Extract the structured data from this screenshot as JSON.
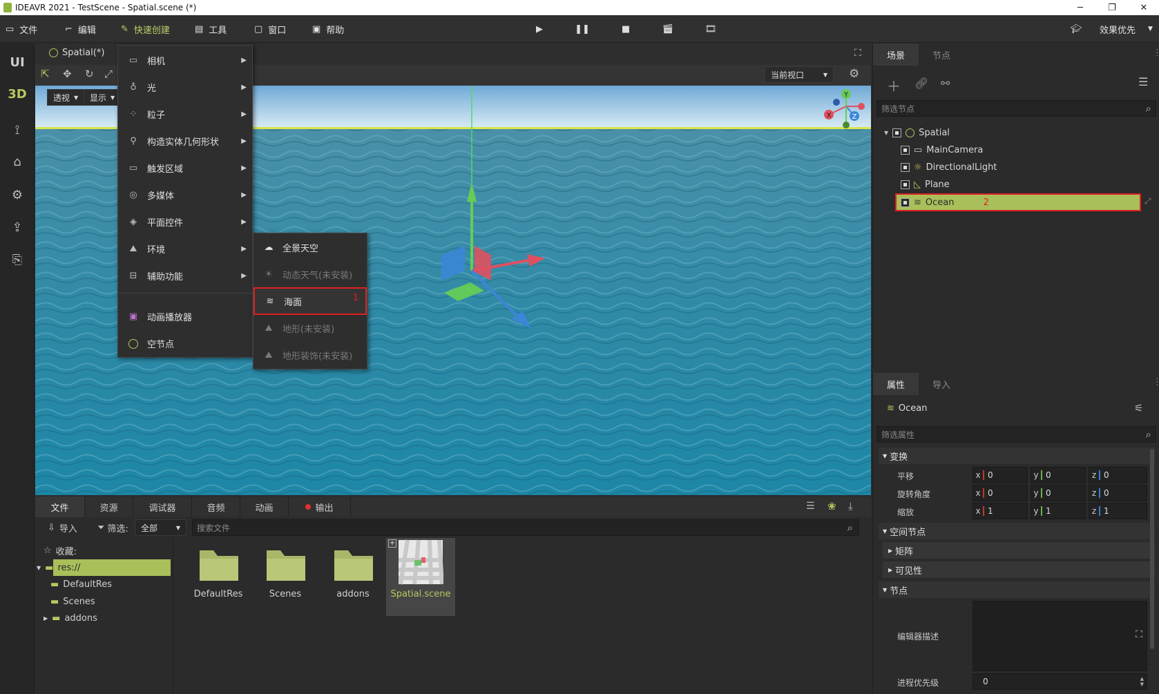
{
  "titlebar": {
    "title": "IDEAVR 2021 - TestScene - Spatial.scene (*)"
  },
  "menu": {
    "file": "文件",
    "edit": "编辑",
    "quick_create": "快速创建",
    "tools": "工具",
    "window": "窗口",
    "help": "帮助",
    "quality": "效果优先"
  },
  "leftbar": {
    "ui": "UI",
    "three_d": "3D"
  },
  "viewport": {
    "tab_label": "Spatial(*)",
    "perspective": "透视",
    "display": "显示",
    "current_view": "当前视口",
    "gizmo_labels": {
      "x": "X",
      "y": "Y",
      "z": "Z"
    }
  },
  "quick_menu": {
    "items": [
      {
        "icon": "camera-icon",
        "label": "相机",
        "has_sub": true
      },
      {
        "icon": "light-icon",
        "label": "光",
        "has_sub": true
      },
      {
        "icon": "particles-icon",
        "label": "粒子",
        "has_sub": true
      },
      {
        "icon": "geometry-icon",
        "label": "构造实体几何形状",
        "has_sub": true
      },
      {
        "icon": "trigger-icon",
        "label": "触发区域",
        "has_sub": true
      },
      {
        "icon": "media-icon",
        "label": "多媒体",
        "has_sub": true
      },
      {
        "icon": "control-icon",
        "label": "平面控件",
        "has_sub": true
      },
      {
        "icon": "environment-icon",
        "label": "环境",
        "has_sub": true
      },
      {
        "icon": "helper-icon",
        "label": "辅助功能",
        "has_sub": true
      },
      {
        "icon": "animation-player-icon",
        "label": "动画播放器",
        "has_sub": false
      },
      {
        "icon": "empty-node-icon",
        "label": "空节点",
        "has_sub": false
      }
    ]
  },
  "sub_menu": {
    "items": [
      {
        "icon": "skybox-icon",
        "label": "全景天空",
        "disabled": false
      },
      {
        "icon": "weather-icon",
        "label": "动态天气(未安装)",
        "disabled": true
      },
      {
        "icon": "ocean-icon",
        "label": "海面",
        "disabled": false
      },
      {
        "icon": "terrain-icon",
        "label": "地形(未安装)",
        "disabled": true
      },
      {
        "icon": "terrain-decor-icon",
        "label": "地形装饰(未安装)",
        "disabled": true
      }
    ],
    "marker_1": "1"
  },
  "scene_panel": {
    "tab_scene": "场景",
    "tab_node": "节点",
    "filter_placeholder": "筛选节点",
    "nodes": [
      {
        "name": "Spatial",
        "icon": "spatial-icon"
      },
      {
        "name": "MainCamera",
        "icon": "camera-icon"
      },
      {
        "name": "DirectionalLight",
        "icon": "sun-icon"
      },
      {
        "name": "Plane",
        "icon": "plane-icon"
      },
      {
        "name": "Ocean",
        "icon": "ocean-icon"
      }
    ],
    "marker_2": "2"
  },
  "props_panel": {
    "tab_props": "属性",
    "tab_import": "导入",
    "node_name": "Ocean",
    "filter_placeholder": "筛选属性",
    "section_transform": "变换",
    "translate": "平移",
    "rotation": "旋转角度",
    "scale": "缩放",
    "translate_values": {
      "x": "0",
      "y": "0",
      "z": "0"
    },
    "rotation_values": {
      "x": "0",
      "y": "0",
      "z": "0"
    },
    "scale_values": {
      "x": "1",
      "y": "1",
      "z": "1"
    },
    "axis_x": "x",
    "axis_y": "y",
    "axis_z": "z",
    "section_spatial": "空间节点",
    "section_matrix": "矩阵",
    "section_visibility": "可见性",
    "section_node": "节点",
    "editor_desc": "编辑器描述",
    "process_priority": "进程优先级",
    "process_priority_value": "0",
    "colors": {
      "x": "#c0392b",
      "y": "#6ab04c",
      "z": "#3a7bd5"
    }
  },
  "file_panel": {
    "tabs": [
      "文件",
      "资源",
      "调试器",
      "音频",
      "动画",
      "输出"
    ],
    "import": "导入",
    "filter_label": "筛选:",
    "filter_value": "全部",
    "search_placeholder": "搜索文件",
    "favorites": "收藏:",
    "tree": [
      "res://",
      "DefaultRes",
      "Scenes",
      "addons"
    ],
    "items": [
      "DefaultRes",
      "Scenes",
      "addons",
      "Spatial.scene"
    ]
  },
  "colors": {
    "accent": "#b4c960",
    "highlight_bg": "#a9bf5a",
    "marker_red": "#e02020"
  }
}
